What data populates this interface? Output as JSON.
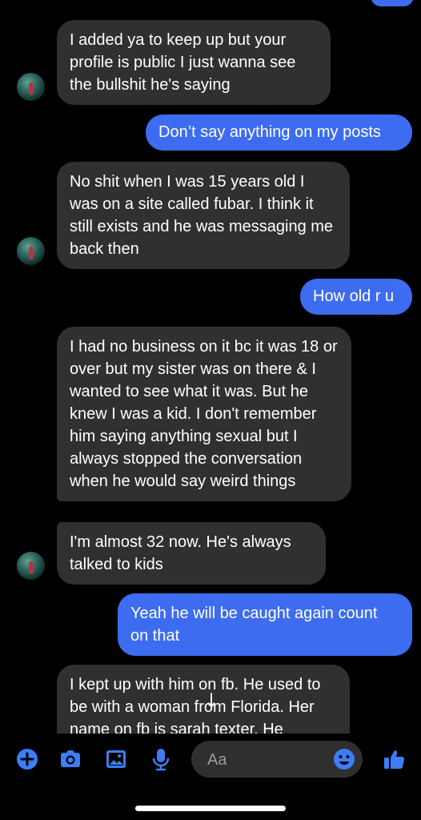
{
  "messages": [
    {
      "dir": "in",
      "text": "I added ya to keep up but your profile is public I just wanna see the bullshit he's saying"
    },
    {
      "dir": "out",
      "text": "Don’t say anything on my posts"
    },
    {
      "dir": "in",
      "text": "No shit when I was 15 years old I was on a site called fubar. I think it still exists and he was messaging me back then"
    },
    {
      "dir": "out",
      "text": "How old r u"
    },
    {
      "dir": "in",
      "text": "I had no business on it bc it was 18 or over but my sister was on there & I wanted to see what it was.  But he knew I was a kid. I don't remember him saying anything sexual but I always stopped the conversation when he would say weird things"
    },
    {
      "dir": "in",
      "text": "I'm almost 32 now. He's always talked to kids"
    },
    {
      "dir": "out",
      "text": "Yeah he will be caught again count on that"
    },
    {
      "dir": "in",
      "text": "I kept up with him on fb. He used to be with a woman from Florida. Her name on fb is sarah texter. He"
    }
  ],
  "composer": {
    "placeholder": "Aa",
    "accent": "#3d7df5",
    "icons": [
      "plus-icon",
      "camera-icon",
      "image-icon",
      "microphone-icon",
      "emoji-icon",
      "thumbs-up-icon"
    ]
  },
  "colors": {
    "incoming": "#303030",
    "outgoing": "#3d6cf0",
    "background": "#000000"
  }
}
